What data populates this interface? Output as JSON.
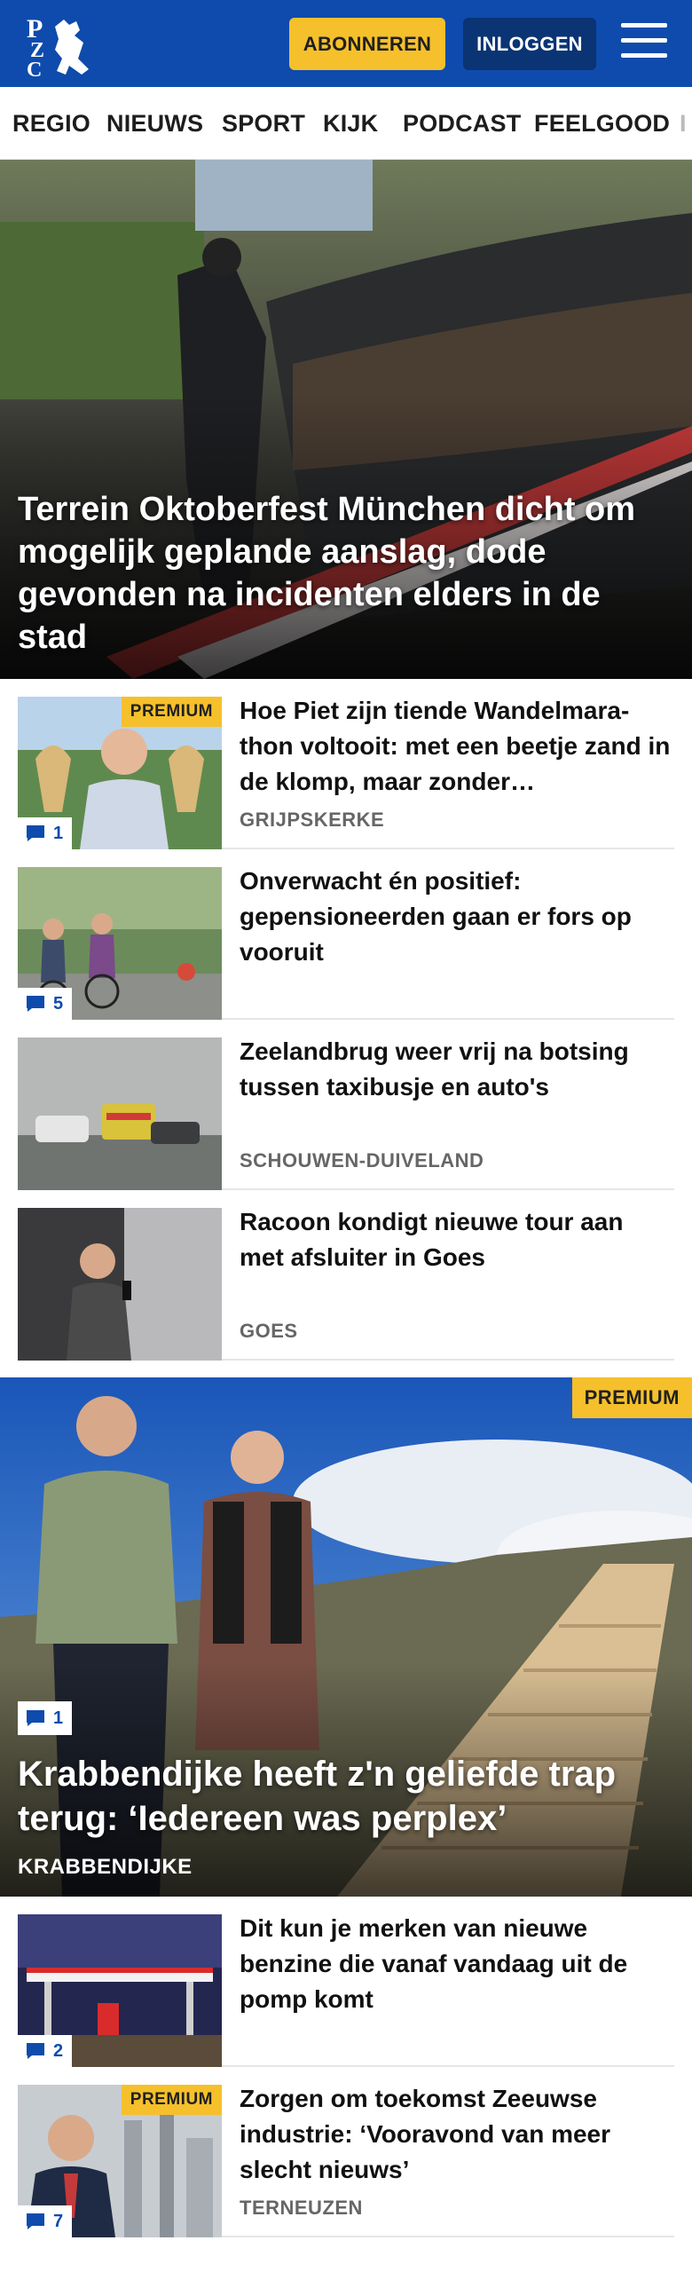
{
  "header": {
    "logo_text": "PZC",
    "subscribe_label": "ABONNEREN",
    "login_label": "INLOGGEN",
    "menu_icon": "hamburger-icon",
    "brand_color": "#0e4bad",
    "accent_color": "#f5c02b"
  },
  "nav": {
    "items": [
      "REGIO",
      "NIEUWS",
      "SPORT",
      "KIJK",
      "PODCAST",
      "FEELGOOD",
      "I"
    ]
  },
  "hero": {
    "title": "Terrein Oktoberfest München dicht om mogelijk geplande aanslag, dode gevonden na incidenten elders in de stad"
  },
  "articles": [
    {
      "title": "Hoe Piet zijn tiende Wandelmara­thon voltooit: met een beetje zand in de klomp, maar zonder…",
      "location": "GRIJPSKERKE",
      "comments": "1",
      "premium": "PREMIUM"
    },
    {
      "title": "Onverwacht én positief: gepensioneerden gaan er fors op vooruit",
      "location": "",
      "comments": "5",
      "premium": ""
    },
    {
      "title": "Zeelandbrug weer vrij na botsing tussen taxibusje en auto's",
      "location": "SCHOUWEN-DUIVELAND",
      "comments": "",
      "premium": ""
    },
    {
      "title": "Racoon kondigt nieuwe tour aan met afsluiter in Goes",
      "location": "GOES",
      "comments": "",
      "premium": ""
    }
  ],
  "feature": {
    "premium": "PREMIUM",
    "comments": "1",
    "title": "Krabbendijke heeft z'n geliefde trap terug: ‘Iedereen was perplex’",
    "location": "KRABBENDIJKE"
  },
  "articles2": [
    {
      "title": "Dit kun je merken van nieuwe benzine die vanaf vandaag uit de pomp komt",
      "location": "",
      "comments": "2",
      "premium": ""
    },
    {
      "title": "Zorgen om toekomst Zeeuwse industrie: ‘Vooravond van meer slecht nieuws’",
      "location": "TERNEUZEN",
      "comments": "7",
      "premium": "PREMIUM"
    }
  ]
}
